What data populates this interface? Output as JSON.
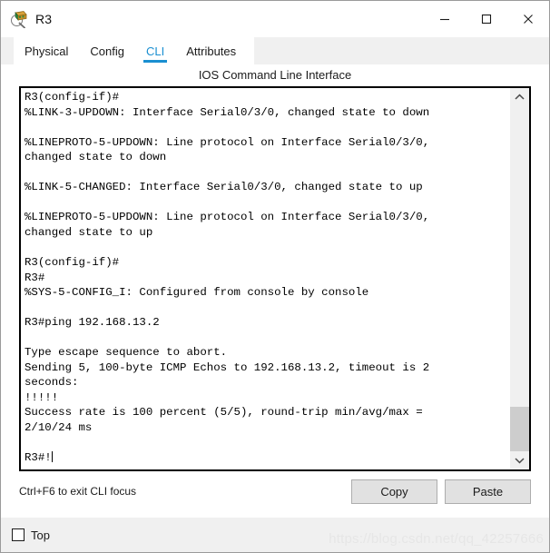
{
  "window": {
    "title": "R3",
    "icon": "router-device-icon",
    "controls": {
      "minimize": "minimize-icon",
      "maximize": "maximize-icon",
      "close": "close-icon"
    }
  },
  "tabs": [
    {
      "label": "Physical",
      "active": false
    },
    {
      "label": "Config",
      "active": false
    },
    {
      "label": "CLI",
      "active": true
    },
    {
      "label": "Attributes",
      "active": false
    }
  ],
  "panel": {
    "heading": "IOS Command Line Interface"
  },
  "terminal": {
    "text": "R3(config-if)#\n%LINK-3-UPDOWN: Interface Serial0/3/0, changed state to down\n\n%LINEPROTO-5-UPDOWN: Line protocol on Interface Serial0/3/0,\nchanged state to down\n\n%LINK-5-CHANGED: Interface Serial0/3/0, changed state to up\n\n%LINEPROTO-5-UPDOWN: Line protocol on Interface Serial0/3/0,\nchanged state to up\n\nR3(config-if)#\nR3#\n%SYS-5-CONFIG_I: Configured from console by console\n\nR3#ping 192.168.13.2\n\nType escape sequence to abort.\nSending 5, 100-byte ICMP Echos to 192.168.13.2, timeout is 2\nseconds:\n!!!!!\nSuccess rate is 100 percent (5/5), round-trip min/avg/max =\n2/10/24 ms\n\nR3#!",
    "scrollbar": {
      "up_icon": "chevron-up-icon",
      "down_icon": "chevron-down-icon",
      "thumb_top_pct": 87,
      "thumb_height_pct": 13
    }
  },
  "footer": {
    "hint": "Ctrl+F6 to exit CLI focus",
    "copy_label": "Copy",
    "paste_label": "Paste"
  },
  "statusbar": {
    "top_checkbox_label": "Top",
    "top_checked": false,
    "watermark": "https://blog.csdn.net/qq_42257666"
  }
}
